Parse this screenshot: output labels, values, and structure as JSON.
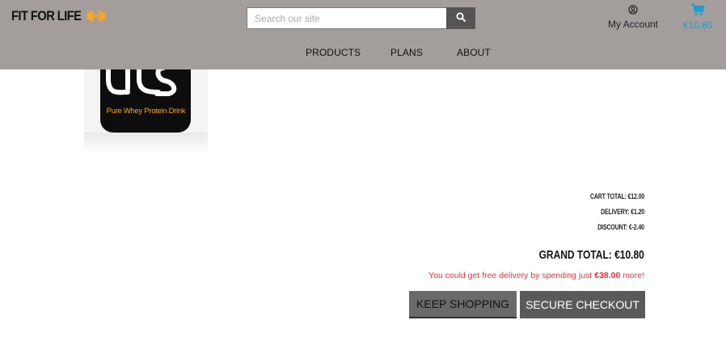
{
  "header": {
    "logo_text": "FIT FOR LIFE",
    "search_placeholder": "Search our site",
    "account_label": "My Account",
    "cart_total": "€10.80",
    "nav": [
      "PRODUCTS",
      "PLANS",
      "ABOUT"
    ]
  },
  "colors": {
    "header_bg": "#a39e9c",
    "accent_orange": "#f5a623",
    "cart_blue": "#1a9fd0",
    "alert_red": "#e0353a",
    "button_dark": "#555555"
  },
  "product": {
    "label_text": "Pure Whey Protein Drink"
  },
  "summary": {
    "cart_total": "CART TOTAL: €12.00",
    "delivery": "DELIVERY: €1.20",
    "discount": "DISCOUNT: €-2.40",
    "grand_total": "GRAND TOTAL: €10.80",
    "free_delivery_prefix": "You could get free delivery by spending just ",
    "free_delivery_amount": "€38.00",
    "free_delivery_suffix": " more!"
  },
  "actions": {
    "keep_shopping": "KEEP SHOPPING",
    "secure_checkout": "SECURE CHECKOUT"
  },
  "icons": {
    "logo": "dumbbell-icon",
    "search": "search-icon",
    "account": "user-circle-icon",
    "cart": "shopping-cart-icon"
  }
}
